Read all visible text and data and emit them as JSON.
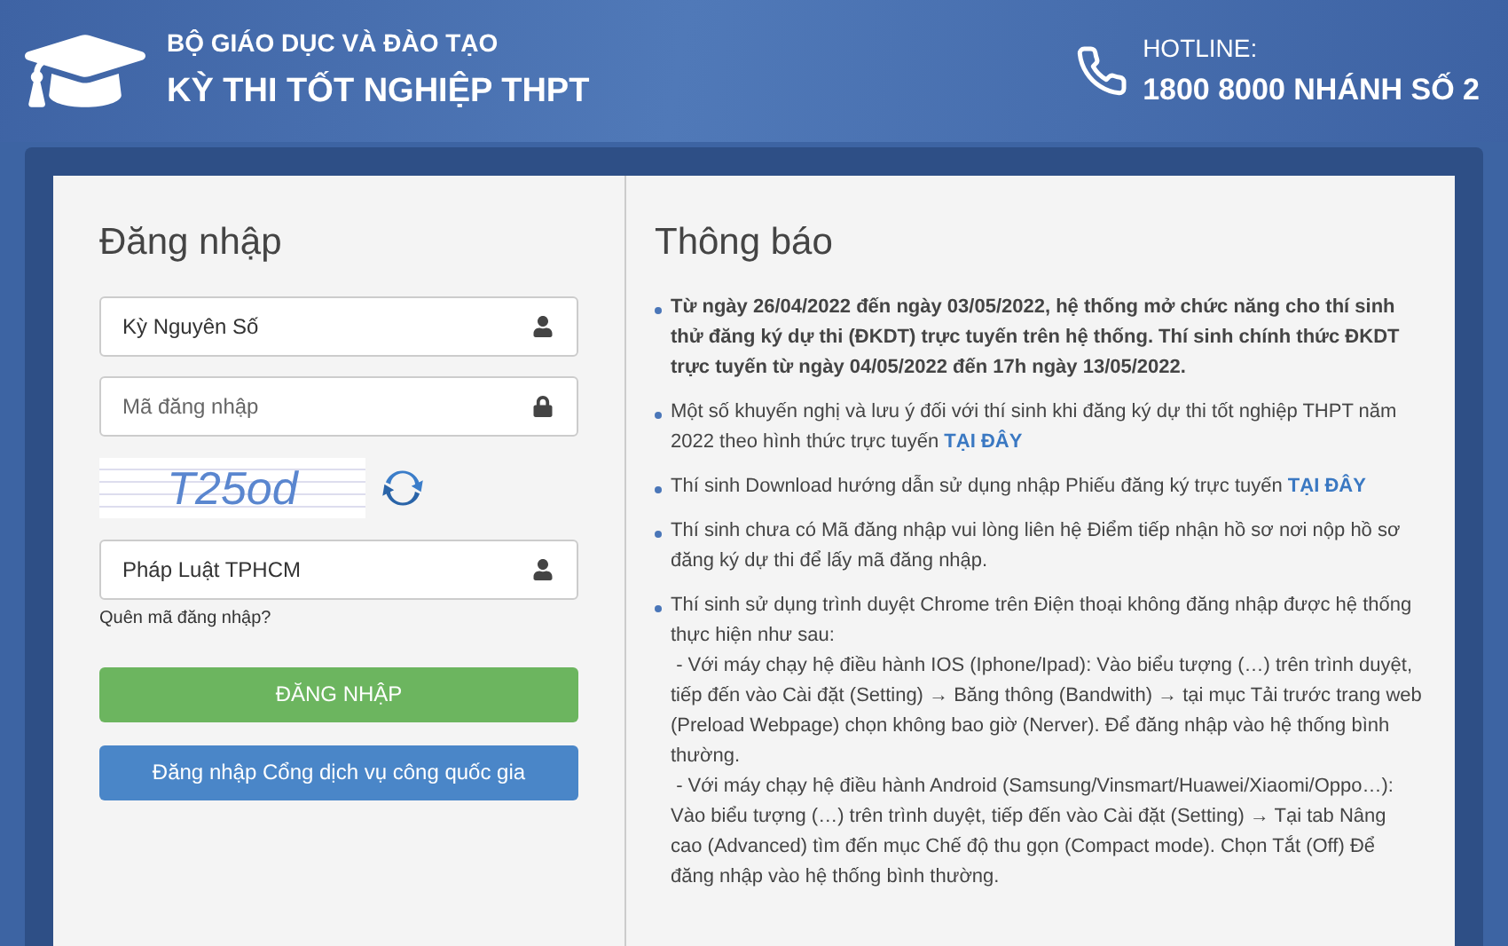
{
  "header": {
    "ministry": "BỘ GIÁO DỤC VÀ ĐÀO TẠO",
    "exam": "KỲ THI TỐT NGHIỆP THPT",
    "hotline_label": "HOTLINE:",
    "hotline_number": "1800 8000 NHÁNH SỐ 2"
  },
  "login": {
    "title": "Đăng nhập",
    "fields": [
      {
        "kind": "user",
        "value": "Kỳ Nguyên Số"
      },
      {
        "kind": "lock",
        "placeholder": "Mã đăng nhập"
      },
      {
        "kind": "captcha",
        "captcha": "T25od"
      },
      {
        "kind": "user",
        "value": "Pháp Luật TPHCM"
      }
    ],
    "forgot_link": "Quên mã đăng nhập?",
    "login_button": "ĐĂNG NHẬP",
    "portal_button": "Đăng nhập Cổng dịch vụ công quốc gia"
  },
  "notices": {
    "title": "Thông báo",
    "items": [
      {
        "kind": "bold",
        "text": "Từ ngày 26/04/2022 đến ngày 03/05/2022, hệ thống mở chức năng cho thí sinh thử đăng ký dự thi (ĐKDT) trực tuyến trên hệ thống. Thí sinh chính thức ĐKDT trực tuyến từ ngày 04/05/2022 đến 17h ngày 13/05/2022."
      },
      {
        "kind": "plain",
        "text": "Một số khuyến nghị và lưu ý đối với thí sinh khi đăng ký dự thi tốt nghiệp THPT năm 2022 theo hình thức trực tuyến",
        "link": "TẠI ĐÂY"
      },
      {
        "kind": "plain",
        "text": "Thí sinh Download hướng dẫn sử dụng nhập Phiếu đăng ký trực tuyến",
        "link": "TẠI ĐÂY"
      },
      {
        "kind": "plain",
        "text": "Thí sinh chưa có Mã đăng nhập vui lòng liên hệ Điểm tiếp nhận hồ sơ nơi nộp hồ sơ đăng ký dự thi để lấy mã đăng nhập."
      },
      {
        "kind": "plain",
        "text": "Thí sinh sử dụng trình duyệt Chrome trên Điện thoại không đăng nhập được hệ thống thực hiện như sau:",
        "details": [
          " - Với máy chạy hệ điều hành IOS (Iphone/Ipad): Vào biểu tượng (…) trên trình duyệt, tiếp đến vào Cài đặt (Setting) → Băng thông (Bandwith) → tại mục Tải trước trang web (Preload Webpage) chọn không bao giờ (Nerver). Để đăng nhập vào hệ thống bình thường.",
          " - Với máy chạy hệ điều hành Android (Samsung/Vinsmart/Huawei/Xiaomi/Oppo…): Vào biểu tượng (…) trên trình duyệt, tiếp đến vào Cài đặt (Setting) → Tại tab Nâng cao (Advanced) tìm đến mục Chế độ thu gọn (Compact mode). Chọn Tắt (Off) Để đăng nhập vào hệ thống bình thường."
        ]
      }
    ]
  }
}
